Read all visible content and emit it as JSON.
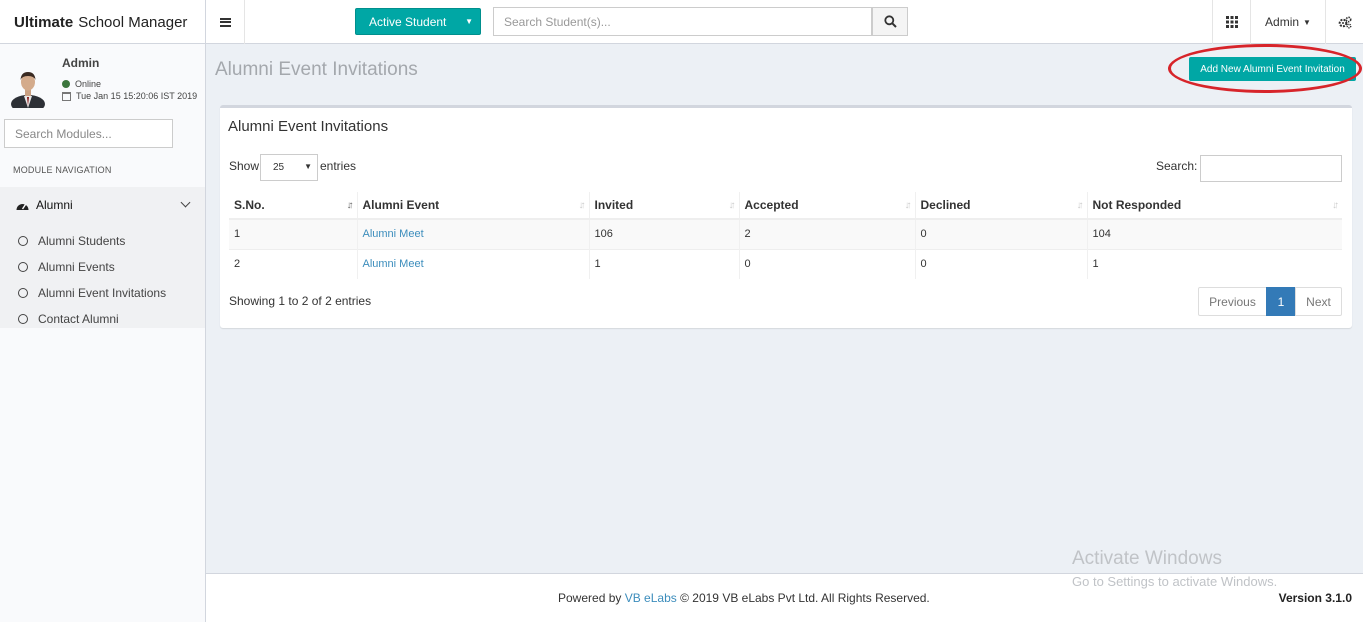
{
  "header": {
    "brand_bold": "Ultimate",
    "brand_rest": "School Manager",
    "active_student_label": "Active Student",
    "search_placeholder": "Search Student(s)...",
    "user_menu_label": "Admin"
  },
  "sidebar": {
    "user_name": "Admin",
    "status": "Online",
    "datetime": "Tue Jan 15 15:20:06 IST 2019",
    "module_search_placeholder": "Search Modules...",
    "nav_header": "MODULE NAVIGATION",
    "group_label": "Alumni",
    "items": [
      {
        "label": "Alumni Students"
      },
      {
        "label": "Alumni Events"
      },
      {
        "label": "Alumni Event Invitations"
      },
      {
        "label": "Contact Alumni"
      }
    ]
  },
  "content": {
    "page_title": "Alumni Event Invitations",
    "add_button_label": "Add New Alumni Event Invitation",
    "box_title": "Alumni Event Invitations",
    "show_label": "Show",
    "page_length": "25",
    "entries_label": "entries",
    "search_label": "Search:",
    "columns": [
      "S.No.",
      "Alumni Event",
      "Invited",
      "Accepted",
      "Declined",
      "Not Responded"
    ],
    "rows": [
      {
        "sno": "1",
        "event": "Alumni Meet",
        "invited": "106",
        "accepted": "2",
        "declined": "0",
        "not_responded": "104"
      },
      {
        "sno": "2",
        "event": "Alumni Meet",
        "invited": "1",
        "accepted": "0",
        "declined": "0",
        "not_responded": "1"
      }
    ],
    "info": "Showing 1 to 2 of 2 entries",
    "pagination": {
      "prev": "Previous",
      "current": "1",
      "next": "Next"
    }
  },
  "footer": {
    "powered_by": "Powered by",
    "company_link": "VB eLabs",
    "copyright": "© 2019 VB eLabs Pvt Ltd. All Rights Reserved.",
    "version": "Version 3.1.0"
  },
  "watermark": {
    "line1": "Activate Windows",
    "line2": "Go to Settings to activate Windows."
  },
  "colors": {
    "accent": "#00a7a5",
    "link": "#3c8dbc",
    "page_active": "#337ab7",
    "highlight_ring": "#d7242a"
  }
}
